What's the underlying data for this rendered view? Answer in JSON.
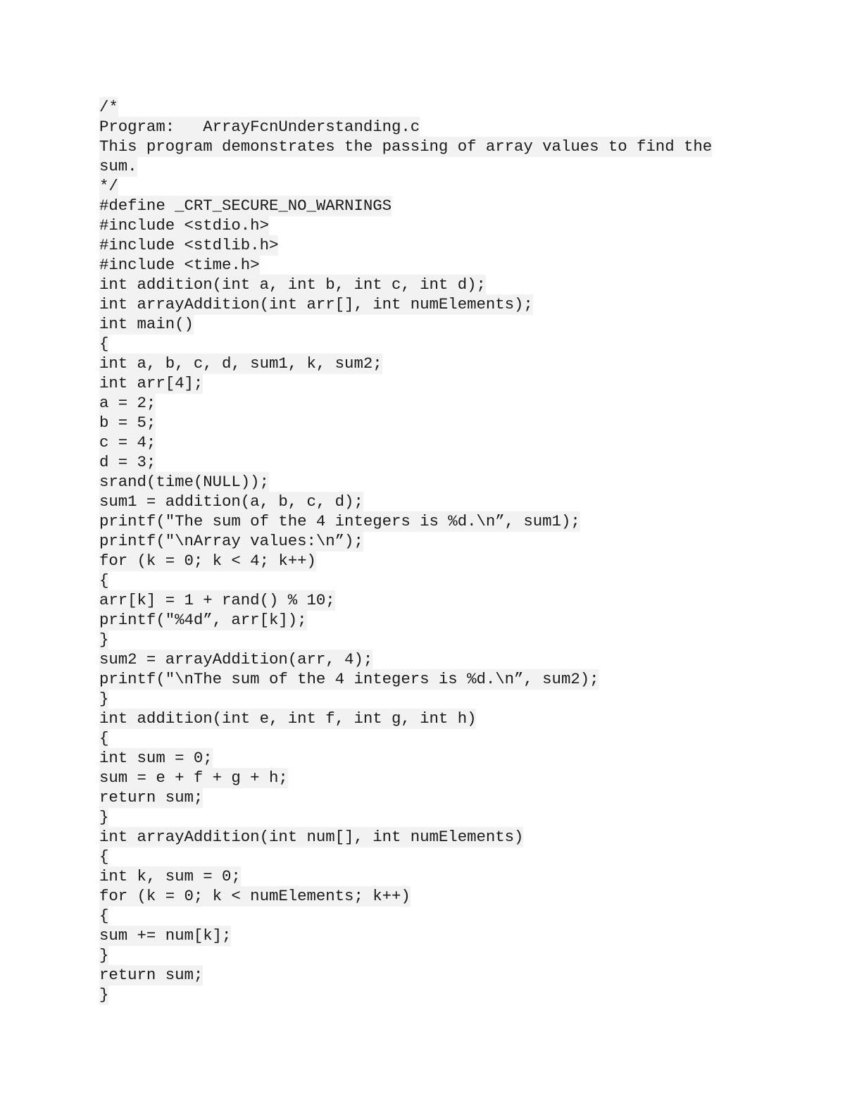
{
  "document": {
    "type": "source-code-listing",
    "language": "C",
    "file_name": "ArrayFcnUnderstanding.c",
    "highlight_color": "#f2f2f2",
    "text_color": "#1a1a1a",
    "page_background": "#ffffff",
    "lines": [
      "/*",
      "Program:   ArrayFcnUnderstanding.c",
      "This program demonstrates the passing of array values to find the",
      "sum.",
      "*/",
      "#define _CRT_SECURE_NO_WARNINGS",
      "#include <stdio.h>",
      "#include <stdlib.h>",
      "#include <time.h>",
      "int addition(int a, int b, int c, int d);",
      "int arrayAddition(int arr[], int numElements);",
      "int main()",
      "{",
      "int a, b, c, d, sum1, k, sum2;",
      "int arr[4];",
      "a = 2;",
      "b = 5;",
      "c = 4;",
      "d = 3;",
      "srand(time(NULL));",
      "sum1 = addition(a, b, c, d);",
      "printf(\"The sum of the 4 integers is %d.\\n”, sum1);",
      "printf(\"\\nArray values:\\n”);",
      "for (k = 0; k < 4; k++)",
      "{",
      "arr[k] = 1 + rand() % 10;",
      "printf(\"%4d”, arr[k]);",
      "}",
      "sum2 = arrayAddition(arr, 4);",
      "printf(\"\\nThe sum of the 4 integers is %d.\\n”, sum2);",
      "}",
      "int addition(int e, int f, int g, int h)",
      "{",
      "int sum = 0;",
      "sum = e + f + g + h;",
      "return sum;",
      "}",
      "int arrayAddition(int num[], int numElements)",
      "{",
      "int k, sum = 0;",
      "for (k = 0; k < numElements; k++)",
      "{",
      "sum += num[k];",
      "}",
      "return sum;",
      "}"
    ]
  }
}
